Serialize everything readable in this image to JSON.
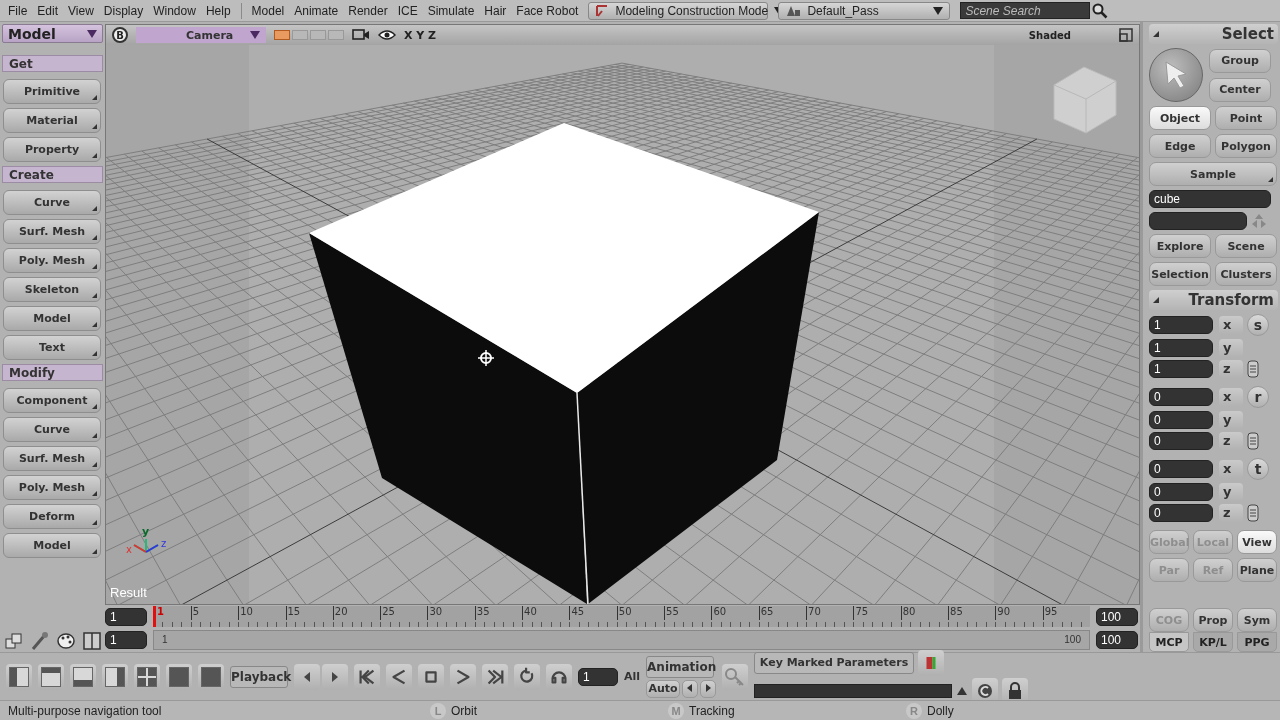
{
  "menubar": {
    "menus": [
      "File",
      "Edit",
      "View",
      "Display",
      "Window",
      "Help"
    ],
    "modules": [
      "Model",
      "Animate",
      "Render",
      "ICE",
      "Simulate",
      "Hair",
      "Face Robot"
    ],
    "mode": "Modeling Construction Mode",
    "pass": "Default_Pass",
    "search": {
      "placeholder": "Scene Search"
    }
  },
  "left_panel": {
    "title": "Model",
    "sections": [
      {
        "title": "Get",
        "items": [
          "Primitive",
          "Material",
          "Property"
        ]
      },
      {
        "title": "Create",
        "items": [
          "Curve",
          "Surf. Mesh",
          "Poly. Mesh",
          "Skeleton",
          "Model",
          "Text"
        ]
      },
      {
        "title": "Modify",
        "items": [
          "Component",
          "Curve",
          "Surf. Mesh",
          "Poly. Mesh",
          "Deform",
          "Model"
        ]
      }
    ]
  },
  "viewport": {
    "badge": "B",
    "camera": "Camera",
    "layouts": [
      {
        "selected": true
      },
      {
        "selected": false
      },
      {
        "selected": false
      },
      {
        "selected": false
      }
    ],
    "axes": "X Y Z",
    "shading": "Shaded",
    "label": "Result",
    "gizmo": [
      "x",
      "y",
      "z"
    ]
  },
  "right_panel": {
    "title": "Select",
    "tools": [
      "Group",
      "Center"
    ],
    "filters": [
      {
        "label": "Object",
        "selected": true
      },
      {
        "label": "Point",
        "selected": false
      },
      {
        "label": "Edge",
        "selected": false
      },
      {
        "label": "Polygon",
        "selected": false
      }
    ],
    "sample": "Sample",
    "name": "cube",
    "explorer": [
      "Explore",
      "Scene",
      "Selection",
      "Clusters"
    ],
    "transform": {
      "title": "Transform",
      "groups": [
        {
          "letter": "s",
          "rows": [
            {
              "axis": "x",
              "value": "1"
            },
            {
              "axis": "y",
              "value": "1"
            },
            {
              "axis": "z",
              "value": "1"
            }
          ]
        },
        {
          "letter": "r",
          "rows": [
            {
              "axis": "x",
              "value": "0"
            },
            {
              "axis": "y",
              "value": "0"
            },
            {
              "axis": "z",
              "value": "0"
            }
          ]
        },
        {
          "letter": "t",
          "rows": [
            {
              "axis": "x",
              "value": "0"
            },
            {
              "axis": "y",
              "value": "0"
            },
            {
              "axis": "z",
              "value": "0"
            }
          ]
        }
      ]
    },
    "reference": [
      {
        "label": "Global",
        "selected": false,
        "disabled": true
      },
      {
        "label": "Local",
        "selected": false,
        "disabled": true
      },
      {
        "label": "View",
        "selected": true,
        "disabled": false
      }
    ],
    "pivot": [
      {
        "label": "Par",
        "disabled": true
      },
      {
        "label": "Ref",
        "disabled": true
      },
      {
        "label": "Plane",
        "disabled": false
      }
    ],
    "options": [
      {
        "label": "COG",
        "disabled": true
      },
      {
        "label": "Prop",
        "disabled": false
      },
      {
        "label": "Sym",
        "disabled": false
      }
    ],
    "tabs": [
      {
        "label": "MCP",
        "selected": true
      },
      {
        "label": "KP/L",
        "selected": false
      },
      {
        "label": "PPG",
        "selected": false
      }
    ]
  },
  "timeline": {
    "start": "1",
    "end": "100",
    "ticks": [
      "1",
      "5",
      "10",
      "15",
      "20",
      "25",
      "30",
      "35",
      "40",
      "45",
      "50",
      "55",
      "60",
      "65",
      "70",
      "75",
      "80",
      "85",
      "90",
      "95"
    ],
    "playhead": {
      "level": 0
    },
    "range_start": "1",
    "range": {
      "level": 1
    },
    "range_min_label": "1",
    "range_max_label": "100",
    "range_end": "100"
  },
  "toolbar": {
    "playback": "Playback",
    "frame": "1",
    "all": "All",
    "animation": "Animation",
    "auto": "Auto",
    "key_marked": "Key Marked Parameters"
  },
  "status": {
    "message": "Multi-purpose navigation tool",
    "mouse": [
      {
        "button": "L",
        "action": "Orbit"
      },
      {
        "button": "M",
        "action": "Tracking"
      },
      {
        "button": "R",
        "action": "Dolly"
      }
    ]
  }
}
